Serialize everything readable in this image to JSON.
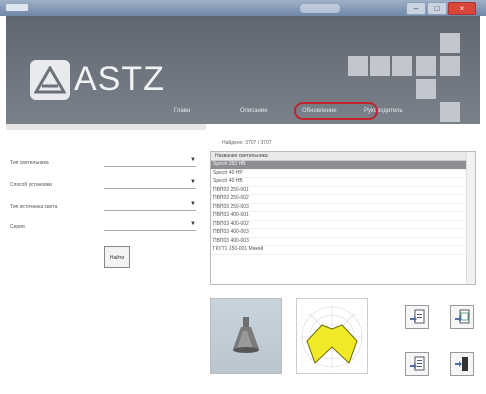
{
  "window": {
    "controls": {
      "minimize": "–",
      "maximize": "□",
      "close": "×"
    }
  },
  "header": {
    "logo_text": "ASTZ",
    "nav": [
      {
        "label": "Главн"
      },
      {
        "label": "Описание"
      },
      {
        "label": "Обновление"
      },
      {
        "label": "Руководитель"
      }
    ],
    "highlight_color": "#c2232c"
  },
  "filters": {
    "items": [
      {
        "label": "Тип светильника",
        "value": ""
      },
      {
        "label": "Способ установки",
        "value": ""
      },
      {
        "label": "Тип источника света",
        "value": ""
      },
      {
        "label": "Серия",
        "value": ""
      }
    ],
    "find_button": "Найти"
  },
  "results": {
    "found_text": "Найдено: 3707 / 3707",
    "column_header": "Название светильника",
    "rows": [
      {
        "name": "Spectr 250 HB",
        "selected": true
      },
      {
        "name": "Spectr 40 HP",
        "selected": false
      },
      {
        "name": "Spectr 40 HB",
        "selected": false
      },
      {
        "name": "ПВП03 250-001",
        "selected": false
      },
      {
        "name": "ПВП03 250-002",
        "selected": false
      },
      {
        "name": "ПВП03 250-003",
        "selected": false
      },
      {
        "name": "ПВП03 400-001",
        "selected": false
      },
      {
        "name": "ПВП03 400-002",
        "selected": false
      },
      {
        "name": "ПВП03 400-003",
        "selected": false
      },
      {
        "name": "ПВП03 400-003",
        "selected": false
      },
      {
        "name": "ГКУ71 150-001 Микей",
        "selected": false
      }
    ]
  },
  "icons": {
    "logo": "astz-logo-icon",
    "tools": [
      "export-word-icon",
      "export-excel-icon",
      "export-doc-icon",
      "exit-icon"
    ]
  },
  "colors": {
    "banner": "#6c737c",
    "selected_row": "#8d8f93",
    "diagram_fill": "#f2ea29"
  }
}
